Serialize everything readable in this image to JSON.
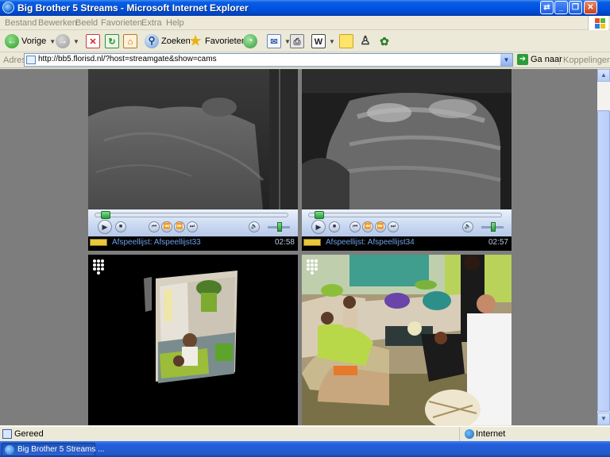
{
  "window": {
    "title": "Big Brother 5 Streams - Microsoft Internet Explorer",
    "controls": [
      "🗕",
      "🗗",
      "✕"
    ]
  },
  "menu": {
    "items": [
      "Bestand",
      "Bewerken",
      "Beeld",
      "Favorieten",
      "Extra",
      "Help"
    ]
  },
  "toolbar": {
    "back_label": "Vorige",
    "search_label": "Zoeken",
    "favorites_label": "Favorieten"
  },
  "address": {
    "label": "Adres",
    "url": "http://bb5.florisd.nl/?host=streamgate&show=cams",
    "go_label": "Ga naar",
    "links_label": "Koppelingen"
  },
  "players": [
    {
      "playlist": "Afspeellijst: Afspeellijst33",
      "time": "02:58",
      "progress": 0.02
    },
    {
      "playlist": "Afspeellijst: Afspeellijst34",
      "time": "02:57",
      "progress": 0.02
    }
  ],
  "statusbar": {
    "text": "Gereed",
    "zone": "Internet"
  },
  "taskbar": {
    "window_button": "Big Brother 5 Streams ..."
  },
  "colors": {
    "titlebar": "#0054e3",
    "page_background": "#7d7d7d",
    "taskbar": "#245edb"
  }
}
